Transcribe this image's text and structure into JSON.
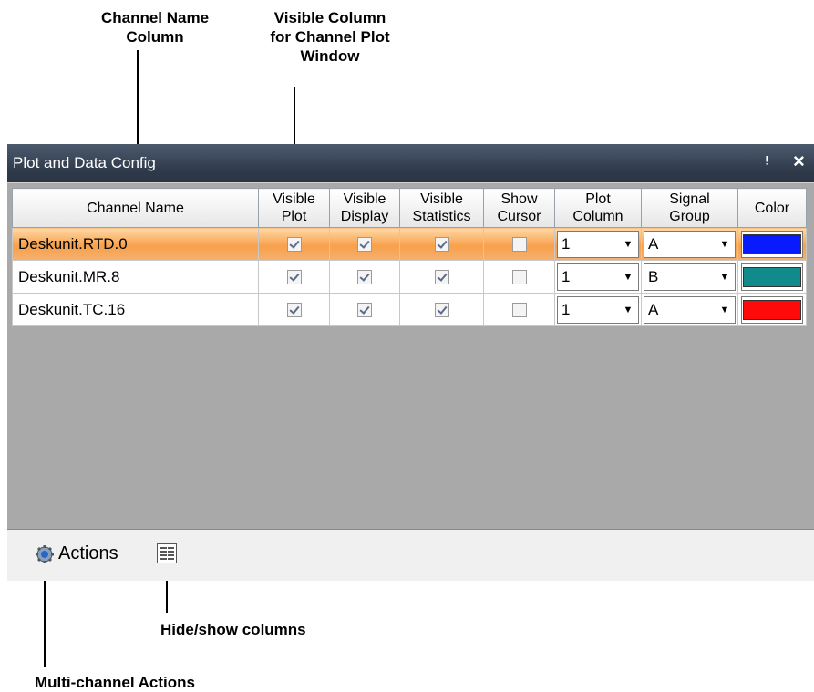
{
  "annotations": {
    "channel_name_column": "Channel Name\nColumn",
    "visible_column": "Visible Column\nfor Channel Plot\nWindow",
    "hide_show_columns": "Hide/show columns",
    "multi_channel_actions": "Multi-channel Actions"
  },
  "window": {
    "title": "Plot and Data Config",
    "pin_icon": "pin-icon",
    "close_icon": "close-icon"
  },
  "table": {
    "headers": {
      "channel_name": "Channel Name",
      "visible_plot": "Visible\nPlot",
      "visible_display": "Visible\nDisplay",
      "visible_statistics": "Visible\nStatistics",
      "show_cursor": "Show\nCursor",
      "plot_column": "Plot\nColumn",
      "signal_group": "Signal\nGroup",
      "color": "Color"
    },
    "rows": [
      {
        "name": "Deskunit.RTD.0",
        "visible_plot": true,
        "visible_display": true,
        "visible_statistics": true,
        "show_cursor": false,
        "plot_column": "1",
        "signal_group": "A",
        "color": "#0a1aff",
        "selected": true
      },
      {
        "name": "Deskunit.MR.8",
        "visible_plot": true,
        "visible_display": true,
        "visible_statistics": true,
        "show_cursor": false,
        "plot_column": "1",
        "signal_group": "B",
        "color": "#108a8a",
        "selected": false
      },
      {
        "name": "Deskunit.TC.16",
        "visible_plot": true,
        "visible_display": true,
        "visible_statistics": true,
        "show_cursor": false,
        "plot_column": "1",
        "signal_group": "A",
        "color": "#ff0a0a",
        "selected": false
      }
    ]
  },
  "footer": {
    "actions_label": "Actions",
    "actions_icon": "gear-icon",
    "columns_icon": "columns-icon"
  }
}
